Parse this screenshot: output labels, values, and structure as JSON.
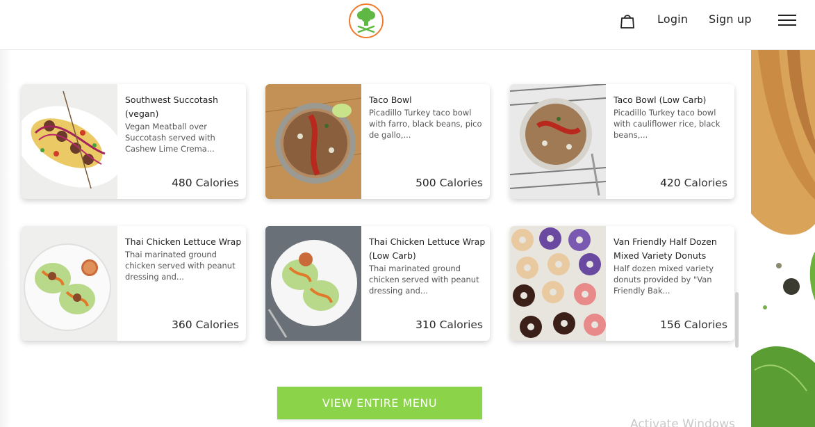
{
  "header": {
    "logo_icon": "broccoli-chef-logo-icon",
    "cart_icon": "shopping-bag-icon",
    "login_label": "Login",
    "signup_label": "Sign up",
    "menu_icon": "hamburger-menu-icon"
  },
  "colors": {
    "accent": "#8bd449",
    "logo_ring": "#f07b2e",
    "logo_green": "#5fb843"
  },
  "cards": [
    {
      "title": "Southwest Succotash (vegan)",
      "desc": "Vegan Meatball over Succotash served with Cashew Lime Crema...",
      "calories": "480",
      "calories_unit": "Calories"
    },
    {
      "title": "Taco Bowl",
      "desc": "Picadillo Turkey taco bowl with farro, black beans, pico de gallo,...",
      "calories": "500",
      "calories_unit": "Calories"
    },
    {
      "title": "Taco Bowl (Low Carb)",
      "desc": "Picadillo Turkey taco bowl with cauliflower rice, black beans,...",
      "calories": "420",
      "calories_unit": "Calories"
    },
    {
      "title": "Thai Chicken Lettuce Wrap",
      "desc": "Thai marinated ground chicken served with peanut dressing and...",
      "calories": "360",
      "calories_unit": "Calories"
    },
    {
      "title": "Thai Chicken Lettuce Wrap (Low Carb)",
      "desc": "Thai marinated ground chicken served with peanut dressing and...",
      "calories": "310",
      "calories_unit": "Calories"
    },
    {
      "title": "Van Friendly Half Dozen Mixed Variety Donuts",
      "desc": "Half dozen mixed variety donuts provided by \"Van Friendly Bak...",
      "calories": "156",
      "calories_unit": "Calories"
    }
  ],
  "cta": {
    "label": "VIEW ENTIRE MENU"
  },
  "watermark": "Activate Windows"
}
